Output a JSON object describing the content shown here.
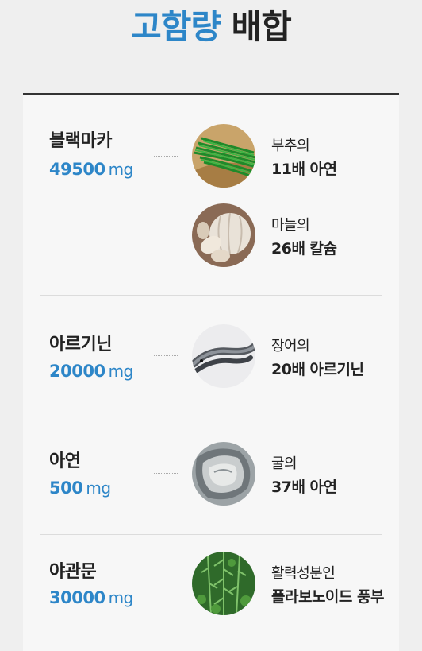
{
  "title": {
    "accent": "고함량",
    "rest": "배합"
  },
  "ingredients": [
    {
      "name": "블랙마카",
      "amount": "49500",
      "unit": "mg"
    },
    {
      "name": "아르기닌",
      "amount": "20000",
      "unit": "mg"
    },
    {
      "name": "아연",
      "amount": "500",
      "unit": "mg"
    },
    {
      "name": "야관문",
      "amount": "30000",
      "unit": "mg"
    }
  ],
  "comparisons": [
    {
      "line1": "부추의",
      "line2": "11배 아연",
      "icon": "chives-icon"
    },
    {
      "line1": "마늘의",
      "line2": "26배 칼슘",
      "icon": "garlic-icon"
    },
    {
      "line1": "장어의",
      "line2": "20배 아르기닌",
      "icon": "eel-icon"
    },
    {
      "line1": "굴의",
      "line2": "37배 아연",
      "icon": "oyster-icon"
    },
    {
      "line1": "활력성분인",
      "line2": "플라보노이드 풍부",
      "icon": "herb-icon"
    }
  ],
  "colors": {
    "accent": "#2d86c8",
    "text": "#222222",
    "background": "#efefef",
    "card": "#f7f7f7"
  }
}
